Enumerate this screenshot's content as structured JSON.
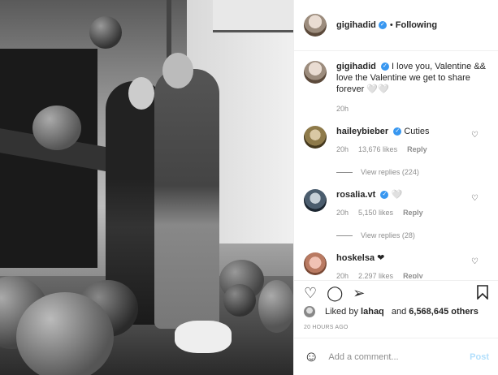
{
  "post": {
    "author": "gigihadid",
    "follow_status": "Following",
    "dot": "•"
  },
  "caption": {
    "username": "gigihadid",
    "text": "I love you, Valentine && love the Valentine we get to share forever 🤍🤍",
    "time": "20h"
  },
  "comments": [
    {
      "username": "haileybieber",
      "text": "Cuties",
      "time": "20h",
      "likes": "13,676 likes",
      "reply": "Reply",
      "view_replies": "View replies (224)"
    },
    {
      "username": "rosalia.vt",
      "text": "🤍",
      "time": "20h",
      "likes": "5,150 likes",
      "reply": "Reply",
      "view_replies": "View replies (28)"
    },
    {
      "username": "hoskelsa",
      "text": "❤",
      "time": "20h",
      "likes": "2,297 likes",
      "reply": "Reply"
    }
  ],
  "icons": {
    "like": "heart-icon",
    "comment": "comment-icon",
    "share": "paper-plane-icon",
    "save": "bookmark-icon",
    "emoji": "smiley-icon",
    "verified": "verified-badge-icon"
  },
  "likes": {
    "prefix": "Liked by",
    "user": "lahaq",
    "joiner": "and",
    "count": "6,568,645 others"
  },
  "post_time": "20 HOURS AGO",
  "add_comment": {
    "placeholder": "Add a comment...",
    "post_label": "Post"
  },
  "colors": {
    "verified": "#3897f0",
    "post_disabled": "#b2dffc",
    "muted": "#8e8e8e"
  }
}
